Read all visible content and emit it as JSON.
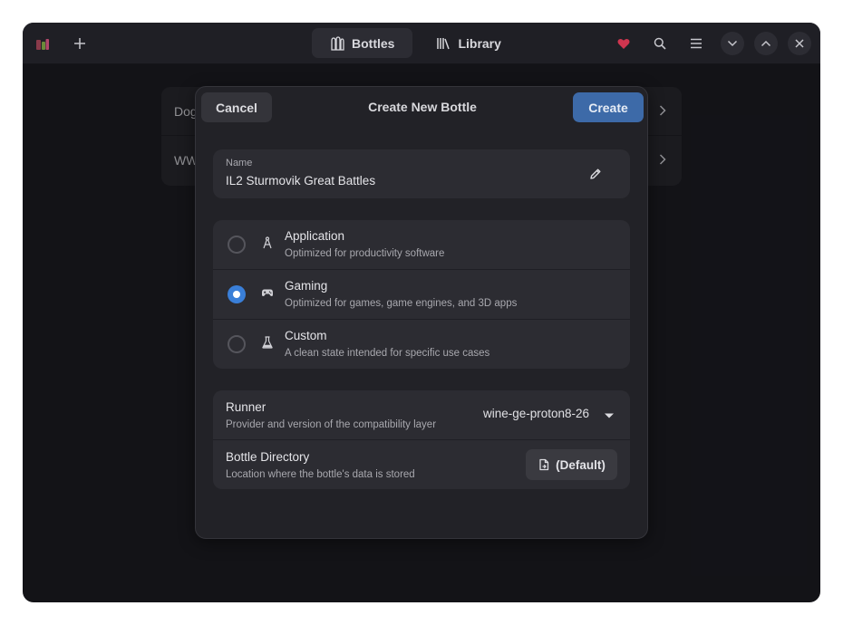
{
  "header": {
    "tabs": [
      {
        "label": "Bottles",
        "active": true
      },
      {
        "label": "Library",
        "active": false
      }
    ]
  },
  "background_list": {
    "items": [
      {
        "label": "Dog"
      },
      {
        "label": "WW"
      }
    ]
  },
  "dialog": {
    "title": "Create New Bottle",
    "cancel_label": "Cancel",
    "create_label": "Create",
    "name": {
      "label": "Name",
      "value": "IL2 Sturmovik Great Battles"
    },
    "environments": [
      {
        "title": "Application",
        "subtitle": "Optimized for productivity software",
        "selected": false,
        "icon": "compass-icon"
      },
      {
        "title": "Gaming",
        "subtitle": "Optimized for games, game engines, and 3D apps",
        "selected": true,
        "icon": "gamepad-icon"
      },
      {
        "title": "Custom",
        "subtitle": "A clean state intended for specific use cases",
        "selected": false,
        "icon": "flask-icon"
      }
    ],
    "runner": {
      "title": "Runner",
      "subtitle": "Provider and version of the compatibility layer",
      "value": "wine-ge-proton8-26"
    },
    "directory": {
      "title": "Bottle Directory",
      "subtitle": "Location where the bottle's data is stored",
      "button_label": "(Default)"
    }
  },
  "colors": {
    "accent": "#3a7fd8",
    "create_button": "#3d6aa8",
    "heart": "#d0354f"
  }
}
